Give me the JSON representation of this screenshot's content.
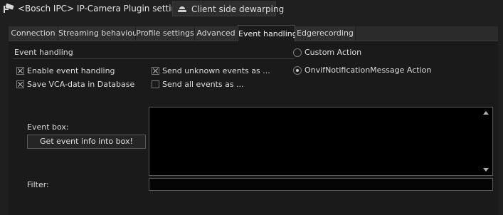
{
  "window": {
    "title": "<Bosch IPC> IP-Camera Plugin settings",
    "plugin_icon": "cctv-camera-icon",
    "dewarp_button": {
      "label": "Client side dewarping",
      "icon": "dome-camera-icon"
    }
  },
  "tabs": [
    {
      "label": "Connection",
      "active": false
    },
    {
      "label": "Streaming behaviour",
      "active": false
    },
    {
      "label": "Profile settings",
      "active": false
    },
    {
      "label": "Advanced",
      "active": false
    },
    {
      "label": "Event handling",
      "active": true
    },
    {
      "label": "Edgerecording",
      "active": false
    }
  ],
  "event_handling": {
    "section_title": "Event handling",
    "checkboxes": [
      {
        "label": "Enable event handling",
        "checked": true
      },
      {
        "label": "Save VCA-data in Database",
        "checked": true
      },
      {
        "label": "Send unknown events as ...",
        "checked": true
      },
      {
        "label": "Send all events as ...",
        "checked": false
      }
    ],
    "radios": [
      {
        "label": "Custom Action",
        "selected": false
      },
      {
        "label": "OnvifNotificationMessage Action",
        "selected": true
      }
    ],
    "event_box_label": "Event box:",
    "event_box_value": "",
    "get_info_button": "Get event info into box!",
    "filter_label": "Filter:",
    "filter_value": ""
  }
}
